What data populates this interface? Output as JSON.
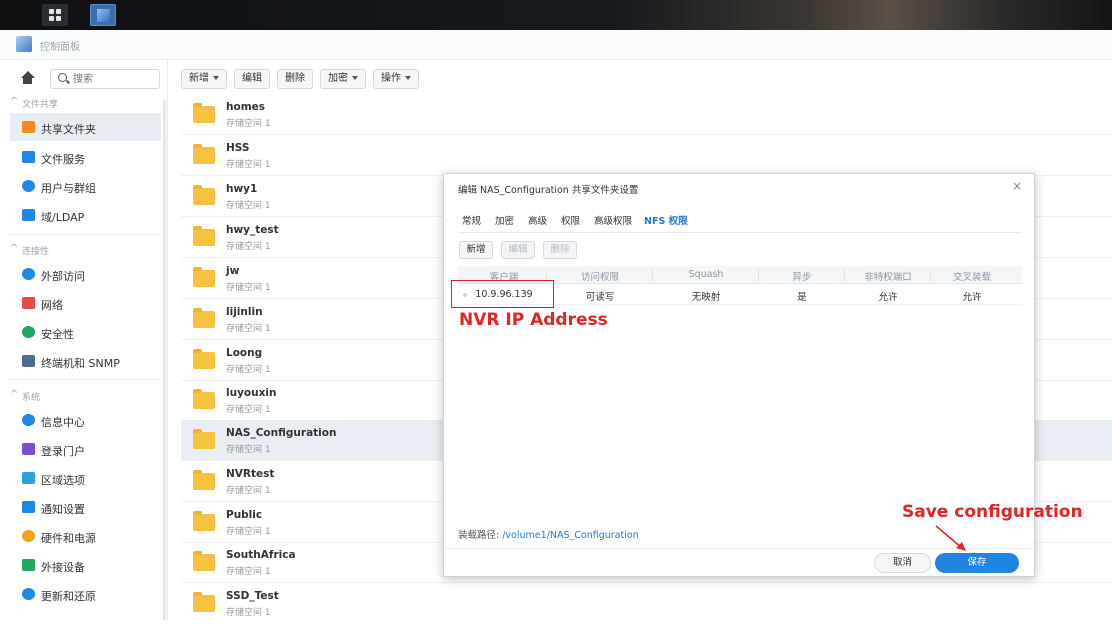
{
  "window": {
    "title": "控制面板"
  },
  "sidebar": {
    "search_placeholder": "搜索",
    "sections": [
      "文件共享",
      "连接性",
      "系统"
    ],
    "items": [
      {
        "label": "共享文件夹",
        "icon": "folder-share-icon",
        "color": "#f28b1e",
        "active": true
      },
      {
        "label": "文件服务",
        "icon": "file-service-icon",
        "color": "#1e88e5"
      },
      {
        "label": "用户与群组",
        "icon": "users-icon",
        "color": "#1e88e5"
      },
      {
        "label": "域/LDAP",
        "icon": "ldap-icon",
        "color": "#1e88e5"
      },
      {
        "label": "外部访问",
        "icon": "external-access-icon",
        "color": "#1e88e5"
      },
      {
        "label": "网络",
        "icon": "network-icon",
        "color": "#e64a4a"
      },
      {
        "label": "安全性",
        "icon": "shield-icon",
        "color": "#1ba860"
      },
      {
        "label": "终端机和 SNMP",
        "icon": "terminal-icon",
        "color": "#4a6d8c"
      },
      {
        "label": "信息中心",
        "icon": "info-icon",
        "color": "#1e88e5"
      },
      {
        "label": "登录门户",
        "icon": "login-portal-icon",
        "color": "#7b4fd0"
      },
      {
        "label": "区域选项",
        "icon": "region-icon",
        "color": "#2aa1d8"
      },
      {
        "label": "通知设置",
        "icon": "notification-icon",
        "color": "#1e88e5"
      },
      {
        "label": "硬件和电源",
        "icon": "power-icon",
        "color": "#f4a31e"
      },
      {
        "label": "外接设备",
        "icon": "external-device-icon",
        "color": "#1ba860"
      },
      {
        "label": "更新和还原",
        "icon": "update-icon",
        "color": "#1e88e5"
      }
    ]
  },
  "toolbar": {
    "new": "新增",
    "edit": "编辑",
    "delete": "删除",
    "encrypt": "加密",
    "action": "操作"
  },
  "folders": [
    {
      "name": "homes",
      "volume": "存储空间 1"
    },
    {
      "name": "HSS",
      "volume": "存储空间 1"
    },
    {
      "name": "hwy1",
      "volume": "存储空间 1"
    },
    {
      "name": "hwy_test",
      "volume": "存储空间 1"
    },
    {
      "name": "jw",
      "volume": "存储空间 1"
    },
    {
      "name": "lijinlin",
      "volume": "存储空间 1"
    },
    {
      "name": "Loong",
      "volume": "存储空间 1"
    },
    {
      "name": "luyouxin",
      "volume": "存储空间 1"
    },
    {
      "name": "NAS_Configuration",
      "volume": "存储空间 1",
      "selected": true
    },
    {
      "name": "NVRtest",
      "volume": "存储空间 1"
    },
    {
      "name": "Public",
      "volume": "存储空间 1"
    },
    {
      "name": "SouthAfrica",
      "volume": "存储空间 1"
    },
    {
      "name": "SSD_Test",
      "volume": "存储空间 1"
    }
  ],
  "dialog": {
    "title": "编辑 NAS_Configuration 共享文件夹设置",
    "close": "×",
    "tabs": [
      "常规",
      "加密",
      "高级",
      "权限",
      "高级权限",
      "NFS 权限"
    ],
    "active_tab": "NFS 权限",
    "buttons": {
      "add": "新增",
      "edit": "编辑",
      "delete": "删除"
    },
    "columns": [
      "客户端",
      "访问权限",
      "Squash",
      "异步",
      "非特权端口",
      "交叉装载"
    ],
    "rows": [
      [
        "10.9.96.139",
        "可读写",
        "无映射",
        "是",
        "允许",
        "允许"
      ]
    ],
    "mount_label": "装载路径:",
    "mount_path": "/volume1/NAS_Configuration",
    "cancel": "取消",
    "save": "保存"
  },
  "annotations": {
    "ip": "NVR IP Address",
    "save": "Save configuration",
    "color": "#e32424"
  }
}
